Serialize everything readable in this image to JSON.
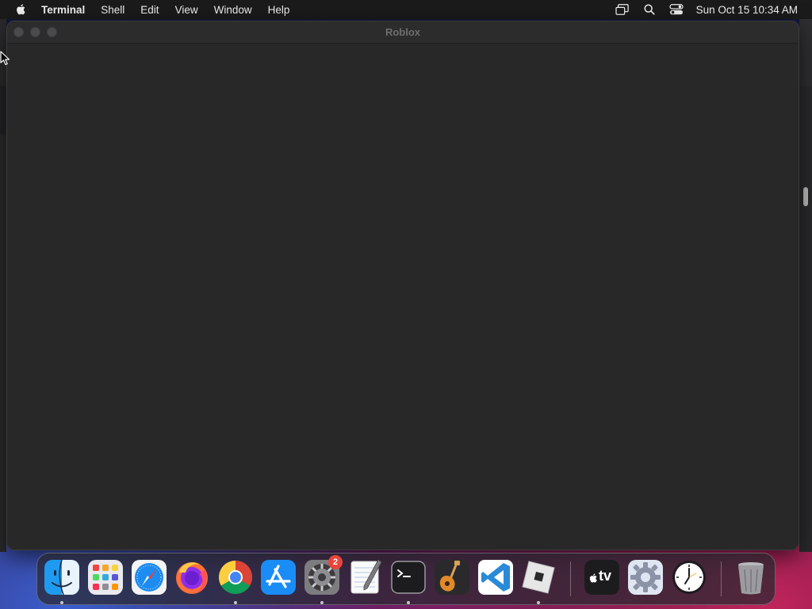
{
  "menubar": {
    "apple_icon": "apple-logo-icon",
    "app_name": "Terminal",
    "items": [
      "Shell",
      "Edit",
      "View",
      "Window",
      "Help"
    ],
    "status_icons": [
      "screen-mirroring-icon",
      "spotlight-search-icon",
      "control-center-icon"
    ],
    "clock": "Sun Oct 15  10:34 AM"
  },
  "window": {
    "title": "Roblox"
  },
  "dock": {
    "items": [
      {
        "name": "Finder",
        "icon": "finder-icon",
        "running": true
      },
      {
        "name": "Launchpad",
        "icon": "launchpad-icon",
        "running": false
      },
      {
        "name": "Safari",
        "icon": "safari-icon",
        "running": false
      },
      {
        "name": "Firefox",
        "icon": "firefox-icon",
        "running": false
      },
      {
        "name": "Google Chrome",
        "icon": "chrome-icon",
        "running": true
      },
      {
        "name": "App Store",
        "icon": "app-store-icon",
        "running": false
      },
      {
        "name": "System Preferences",
        "icon": "system-preferences-icon",
        "running": true,
        "badge": "2"
      },
      {
        "name": "TextEdit",
        "icon": "textedit-icon",
        "running": false
      },
      {
        "name": "Terminal",
        "icon": "terminal-icon",
        "running": true
      },
      {
        "name": "GarageBand",
        "icon": "garageband-icon",
        "running": false
      },
      {
        "name": "Visual Studio Code",
        "icon": "vscode-icon",
        "running": false
      },
      {
        "name": "Roblox",
        "icon": "roblox-icon",
        "running": true
      },
      {
        "name": "Apple TV",
        "icon": "apple-tv-icon",
        "running": false
      },
      {
        "name": "Settings Utility",
        "icon": "settings-gear-icon",
        "running": false
      },
      {
        "name": "Clock",
        "icon": "clock-icon",
        "running": false
      },
      {
        "name": "Trash",
        "icon": "trash-icon",
        "running": false
      }
    ],
    "badge_system_preferences": "2",
    "appletv_label": "tv"
  },
  "colors": {
    "menubar_bg": "#1b1b1c",
    "window_bg": "#282828",
    "badge_red": "#e8453c",
    "vscode_blue": "#2a8ad8"
  }
}
